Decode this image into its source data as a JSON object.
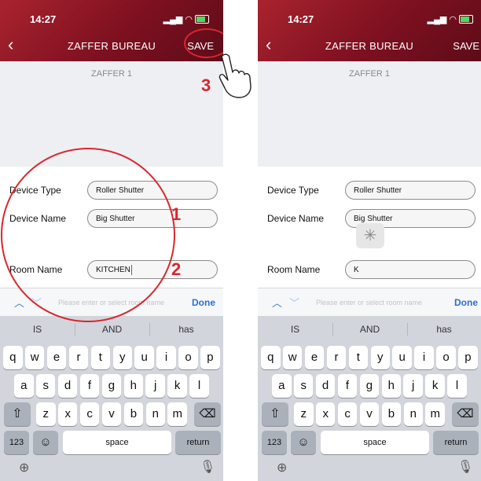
{
  "status": {
    "time": "14:27"
  },
  "header": {
    "back_icon": "chevron-left-icon",
    "title": "ZAFFER BUREAU",
    "save_label": "SAVE"
  },
  "device_label": "ZAFFER 1",
  "form": {
    "device_type_label": "Device Type",
    "device_type_value": "Roller Shutter",
    "device_name_label": "Device Name",
    "device_name_value": "Big Shutter",
    "room_name_label": "Room Name",
    "room_name_value_left": "KITCHEN",
    "room_name_value_right": "K"
  },
  "toolbar": {
    "placeholder": "Please enter or select room name",
    "done_label": "Done"
  },
  "keyboard": {
    "suggestions": [
      "IS",
      "AND",
      "has"
    ],
    "row1": [
      "q",
      "w",
      "e",
      "r",
      "t",
      "y",
      "u",
      "i",
      "o",
      "p"
    ],
    "row2": [
      "a",
      "s",
      "d",
      "f",
      "g",
      "h",
      "j",
      "k",
      "l"
    ],
    "row3": [
      "z",
      "x",
      "c",
      "v",
      "b",
      "n",
      "m"
    ],
    "numbers_label": "123",
    "space_label": "space",
    "return_label": "return",
    "icons": {
      "shift": "shift-icon",
      "backspace": "backspace-icon",
      "emoji": "emoji-icon",
      "globe": "globe-icon",
      "mic": "microphone-icon"
    }
  },
  "annotations": {
    "step1": "1",
    "step2": "2",
    "step3": "3"
  },
  "colors": {
    "header_red": "#8e1a24",
    "annotation_red": "#d9272e",
    "ios_blue": "#2d6ed6",
    "keyboard_gray": "#d2d5db"
  }
}
